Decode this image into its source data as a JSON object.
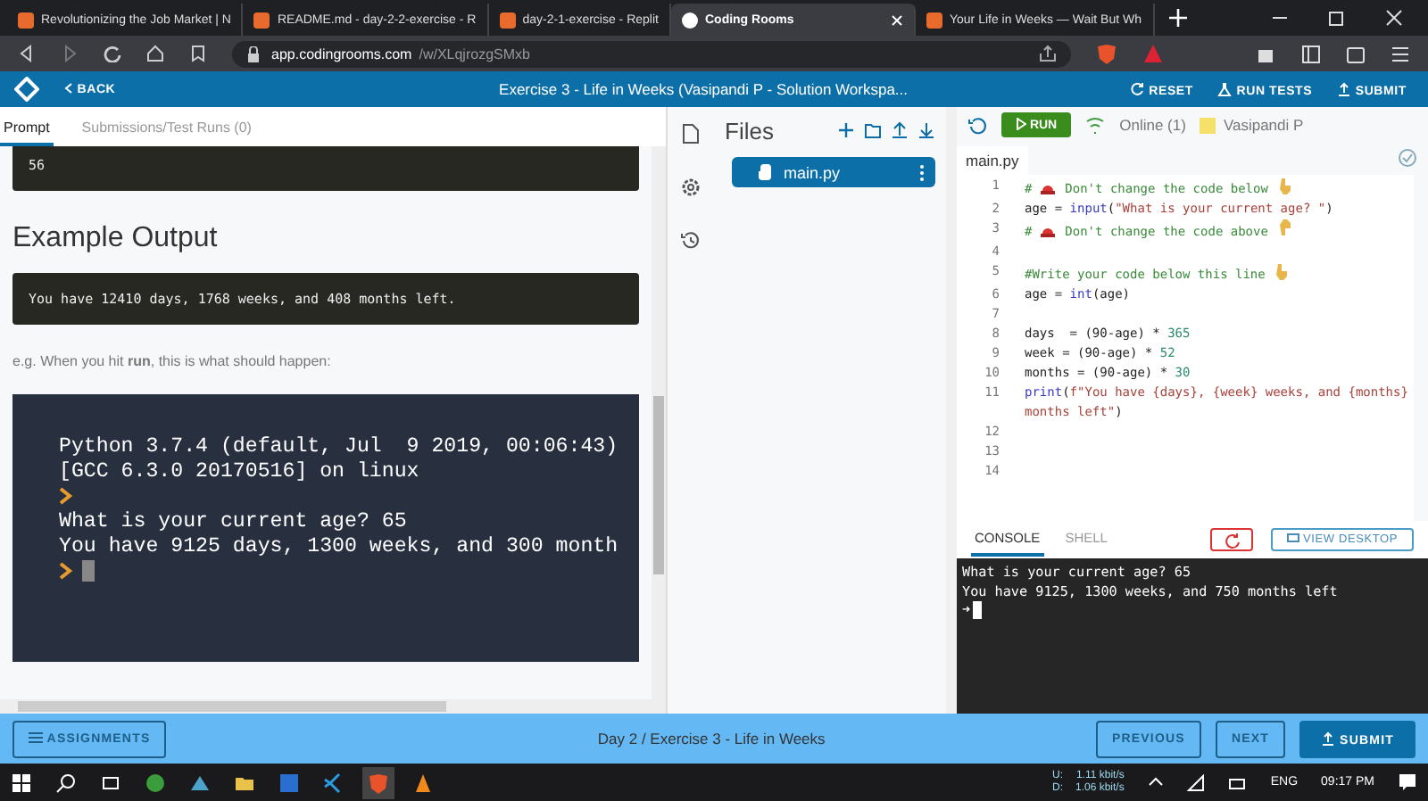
{
  "browser": {
    "tabs": [
      {
        "title": "Revolutionizing the Job Market | N",
        "selected": false
      },
      {
        "title": "README.md - day-2-2-exercise - R",
        "selected": false
      },
      {
        "title": "day-2-1-exercise - Replit",
        "selected": false
      },
      {
        "title": "Coding Rooms",
        "selected": true
      },
      {
        "title": "Your Life in Weeks — Wait But Wh",
        "selected": false
      }
    ],
    "address": {
      "host": "app.codingrooms.com",
      "path": "/w/XLqjrozgSMxb"
    }
  },
  "header": {
    "back": "BACK",
    "title": "Exercise 3 - Life in Weeks (Vasipandi P - Solution Workspa...",
    "actions": [
      "RESET",
      "RUN TESTS",
      "SUBMIT"
    ]
  },
  "prompt": {
    "tabs": [
      {
        "label": "Prompt",
        "selected": true
      },
      {
        "label": "Submissions/Test Runs (0)",
        "selected": false
      }
    ],
    "input_block": "56",
    "heading": "Example Output",
    "output_block": "You have 12410 days, 1768 weeks, and 408 months left.",
    "note": "e.g. When you hit **run**, this is what should happen:",
    "terminal": [
      {
        "kind": "text",
        "text": "Python 3.7.4 (default, Jul  9 2019, 00:06:43)"
      },
      {
        "kind": "text",
        "text": "[GCC 6.3.0 20170516] on linux"
      },
      {
        "kind": "prompt"
      },
      {
        "kind": "text",
        "text": "What is your current age? 65"
      },
      {
        "kind": "text",
        "text": "You have 9125 days, 1300 weeks, and 300 month"
      },
      {
        "kind": "cursor"
      }
    ]
  },
  "files": {
    "title": "Files",
    "items": [
      {
        "name": "main.py",
        "selected": true
      }
    ]
  },
  "editor": {
    "run": "RUN",
    "online": "Online (1)",
    "user": "Vasipandi P",
    "tab": "main.py",
    "lines": [
      {
        "n": "1",
        "tokens": [
          {
            "kind": "comment",
            "text": "# "
          },
          {
            "kind": "siren"
          },
          {
            "kind": "comment",
            "text": " Don't change the code below "
          },
          {
            "kind": "down"
          }
        ]
      },
      {
        "n": "2",
        "tokens": [
          {
            "kind": "plain",
            "text": "age = "
          },
          {
            "kind": "builtin",
            "text": "input"
          },
          {
            "kind": "plain",
            "text": "("
          },
          {
            "kind": "string",
            "text": "\"What is your current age? \""
          },
          {
            "kind": "plain",
            "text": ")"
          }
        ]
      },
      {
        "n": "3",
        "tokens": [
          {
            "kind": "comment",
            "text": "# "
          },
          {
            "kind": "siren"
          },
          {
            "kind": "comment",
            "text": " Don't change the code above "
          },
          {
            "kind": "up"
          }
        ]
      },
      {
        "n": "4"
      },
      {
        "n": "5",
        "tokens": [
          {
            "kind": "comment",
            "text": "#Write your code below this line "
          },
          {
            "kind": "down"
          }
        ]
      },
      {
        "n": "6",
        "tokens": [
          {
            "kind": "plain",
            "text": "age = "
          },
          {
            "kind": "builtin",
            "text": "int"
          },
          {
            "kind": "plain",
            "text": "(age)"
          }
        ]
      },
      {
        "n": "7"
      },
      {
        "n": "8",
        "tokens": [
          {
            "kind": "plain",
            "text": "days  = (90-age) * "
          },
          {
            "kind": "number",
            "text": "365"
          }
        ]
      },
      {
        "n": "9",
        "tokens": [
          {
            "kind": "plain",
            "text": "week = (90-age) * "
          },
          {
            "kind": "number",
            "text": "52"
          }
        ]
      },
      {
        "n": "10",
        "tokens": [
          {
            "kind": "plain",
            "text": "months = (90-age) * "
          },
          {
            "kind": "number",
            "text": "30"
          }
        ]
      },
      {
        "n": "11",
        "tokens": [
          {
            "kind": "builtin",
            "text": "print"
          },
          {
            "kind": "plain",
            "text": "("
          },
          {
            "kind": "string",
            "text": "f\"You have {days}, {week} weeks, and {months} months left\""
          },
          {
            "kind": "plain",
            "text": ")"
          }
        ]
      },
      {
        "n": "12"
      },
      {
        "n": "13"
      },
      {
        "n": "14"
      }
    ]
  },
  "console": {
    "tabs": [
      {
        "label": "CONSOLE",
        "selected": true
      },
      {
        "label": "SHELL",
        "selected": false
      }
    ],
    "view_desktop": "VIEW DESKTOP",
    "lines": [
      "What is your current age? 65",
      "You have 9125, 1300 weeks, and 750 months left"
    ],
    "prompt": "➜"
  },
  "footer": {
    "assignments": "ASSIGNMENTS",
    "breadcrumb": "Day 2 / Exercise 3 - Life in Weeks",
    "previous": "PREVIOUS",
    "next": "NEXT",
    "submit": "SUBMIT"
  },
  "taskbar": {
    "upload_label": "U:",
    "download_label": "D:",
    "upload": "1.11 kbit/s",
    "download": "1.06 kbit/s",
    "language": "ENG",
    "time": "09:17 PM"
  }
}
